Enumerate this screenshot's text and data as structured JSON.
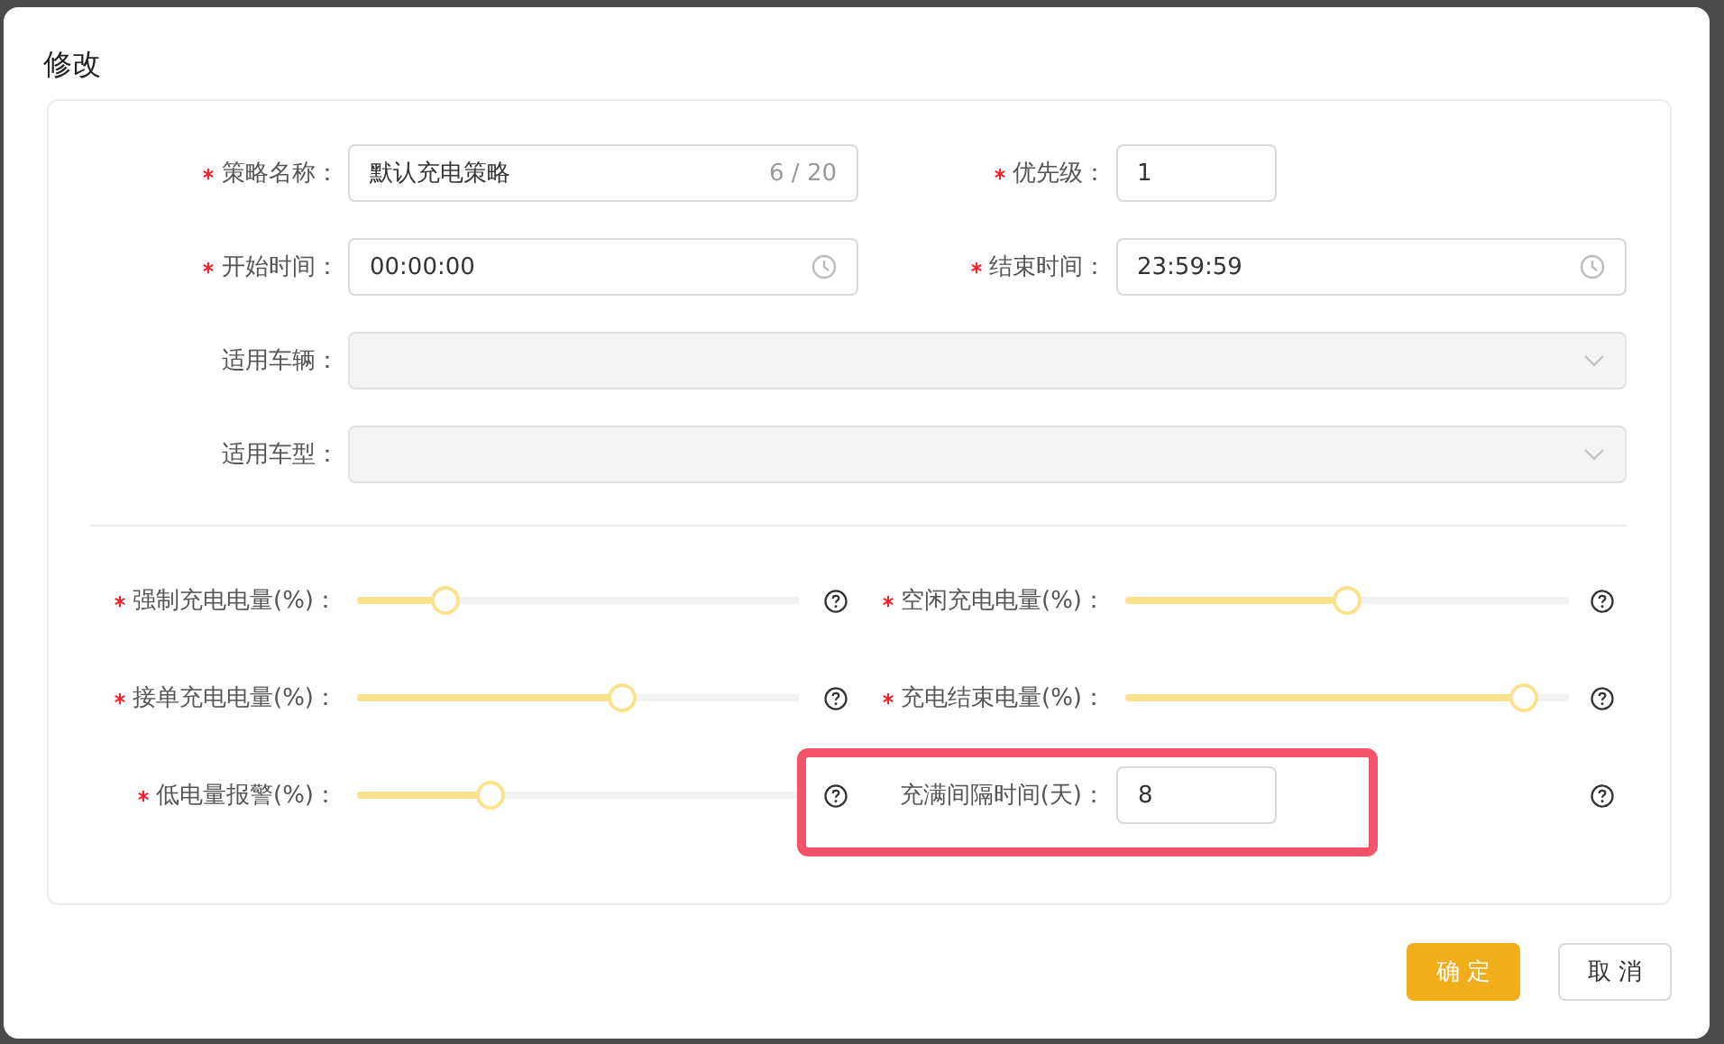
{
  "dialog": {
    "title": "修改"
  },
  "top_rows": [
    {
      "items": [
        {
          "kind": "text",
          "label": "策略名称：",
          "required": true,
          "value": "默认充电策略",
          "counter": "6 / 20"
        },
        {
          "kind": "number",
          "label": "优先级：",
          "required": true,
          "value": "1"
        }
      ]
    },
    {
      "items": [
        {
          "kind": "time",
          "label": "开始时间：",
          "required": true,
          "value": "00:00:00"
        },
        {
          "kind": "time",
          "label": "结束时间：",
          "required": true,
          "value": "23:59:59"
        }
      ]
    },
    {
      "items": [
        {
          "kind": "select",
          "label": "适用车辆：",
          "required": false,
          "disabled": true
        }
      ]
    },
    {
      "items": [
        {
          "kind": "select",
          "label": "适用车型：",
          "required": false,
          "disabled": true
        }
      ]
    }
  ],
  "bottom_rows": [
    {
      "items": [
        {
          "kind": "slider",
          "label": "强制充电电量(%)：",
          "required": true,
          "level": 0.2
        },
        {
          "kind": "slider",
          "label": "空闲充电电量(%)：",
          "required": true,
          "level": 0.5
        }
      ]
    },
    {
      "items": [
        {
          "kind": "slider",
          "label": "接单充电电量(%)：",
          "required": true,
          "level": 0.6
        },
        {
          "kind": "slider",
          "label": "充电结束电量(%)：",
          "required": true,
          "level": 0.9
        }
      ]
    },
    {
      "items": [
        {
          "kind": "slider",
          "label": "低电量报警(%)：",
          "required": true,
          "level": 0.3
        },
        {
          "kind": "number",
          "label": "充满间隔时间(天)：",
          "required": false,
          "value": "8",
          "highlighted": true
        }
      ]
    }
  ],
  "buttons": [
    {
      "kind": "primary",
      "label": "确 定"
    },
    {
      "kind": "default",
      "label": "取 消"
    }
  ]
}
